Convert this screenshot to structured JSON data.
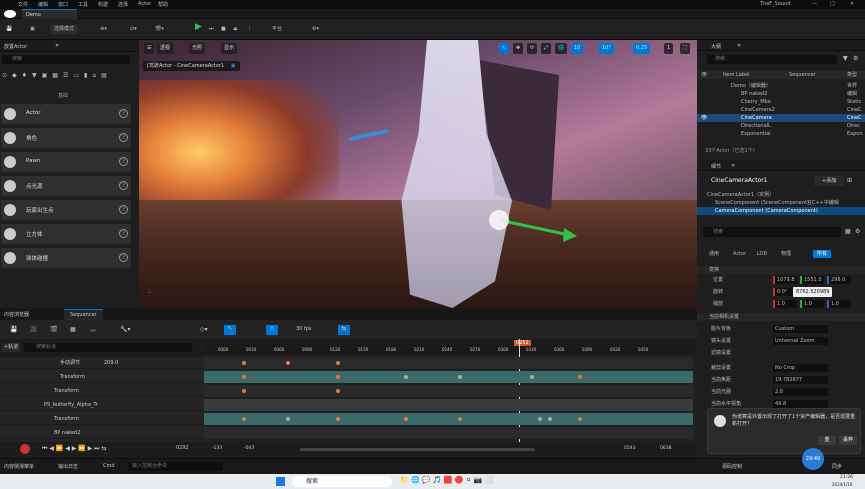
{
  "menubar": {
    "items": [
      "文件",
      "编辑",
      "窗口",
      "工具",
      "构建",
      "选择",
      "Actor",
      "帮助"
    ],
    "project_name": "TheF_Sound"
  },
  "tab": {
    "label": "Demo"
  },
  "toolbar": {
    "mode": "选择模式",
    "platform": "平台"
  },
  "left_panel": {
    "title": "放置Actor",
    "search_placeholder": "搜索",
    "section": "基础",
    "items": [
      "Actor",
      "角色",
      "Pawn",
      "点光源",
      "玩家出生点",
      "立方体",
      "球体碰撞"
    ]
  },
  "viewport": {
    "perspective": "透视",
    "lighting": "光照",
    "show": "显示",
    "pilot_label": "[驾驶Actor - CineCameraActor1",
    "grid_size": "10",
    "rot_snap": "10°",
    "scale_snap": "0.25",
    "cam_speed": "1"
  },
  "outliner": {
    "title": "大纲",
    "search_placeholder": "搜索...",
    "col_label": "Item Label",
    "col_seq": "Sequencer",
    "col_type": "类型",
    "rows": [
      {
        "label": "Demo（编辑器）",
        "type": "世界",
        "selected": false
      },
      {
        "label": "BP naked2",
        "type": "编辑",
        "selected": false
      },
      {
        "label": "Cherry_Mbe",
        "type": "Static",
        "selected": false
      },
      {
        "label": "CineCamera2",
        "type": "CineC",
        "selected": false
      },
      {
        "label": "CineCamera",
        "type": "CineC",
        "selected": true
      },
      {
        "label": "DirectionalL",
        "type": "Direc",
        "selected": false
      },
      {
        "label": "Exponential",
        "type": "Expon",
        "selected": false
      }
    ],
    "footer": "33个Actor（已选1个）"
  },
  "details": {
    "title": "细节",
    "actor_name": "CineCameraActor1",
    "add_button": "+添加",
    "root_component": "CineCameraActor1（实例）",
    "scene_comp": "SceneComponent (SceneComponent)",
    "camera_comp": "CameraComponent (CameraComponent)",
    "edit_in_cpp": "在C++中编辑",
    "search_placeholder": "搜索",
    "filter_tabs": [
      "通用",
      "Actor",
      "LOD",
      "杂项",
      "物理",
      "渲染",
      "流送",
      "所有"
    ],
    "transform_header": "变换",
    "location_label": "位置",
    "rotation_label": "旋转",
    "scale_label": "缩放",
    "loc_x": "1079.8",
    "loc_y": "1551.0",
    "loc_z": "298.0",
    "rot_x": "0.0°",
    "rot_tooltip": "8762.520989",
    "scale_x": "1.0",
    "scale_y": "1.0",
    "scale_z": "1.0",
    "cam_settings_header": "当前相机设置",
    "props": [
      {
        "label": "胶片背板",
        "value": "Custom"
      },
      {
        "label": "镜头设置",
        "value": "Universal Zoom"
      },
      {
        "label": "滤镜设置",
        "value": ""
      },
      {
        "label": "裁剪设置",
        "value": "No Crop"
      },
      {
        "label": "当前焦距",
        "value": "19.782877"
      },
      {
        "label": "当前光圈",
        "value": "2.8"
      },
      {
        "label": "当前水平视角",
        "value": "49.8"
      }
    ]
  },
  "toast": {
    "message": "伪谱算是外置出现了打开了1个资产编辑器，是否需要重新打开？",
    "button": "重",
    "dismiss_button": "丢弃"
  },
  "sequencer": {
    "tabs": [
      "内容浏览器",
      "Sequencer"
    ],
    "fps": "30 fps",
    "add_track": "+轨道",
    "search_placeholder": "搜索轨道",
    "tracks": [
      {
        "label": "手动调节",
        "value": "209.0"
      },
      {
        "label": "Transform",
        "value": ""
      },
      {
        "label": "Transform",
        "value": ""
      },
      {
        "label": "PS_butterfly_Alpha_Tr",
        "value": ""
      },
      {
        "label": "Transform",
        "value": ""
      },
      {
        "label": "BP naked2",
        "value": ""
      }
    ],
    "ruler": [
      "0000",
      "0030",
      "0060",
      "0090",
      "0120",
      "0150",
      "0180",
      "0210",
      "0240",
      "0270",
      "0300",
      "0330",
      "0360",
      "0390",
      "0420",
      "0450"
    ],
    "playhead": "0252",
    "current_frame": "0292",
    "range_start": "-133",
    "range_start2": "-043",
    "range_end": "0543",
    "range_end2": "0638"
  },
  "statusbar": {
    "content_drawer": "内容侧滑菜单",
    "output_log": "输出日志",
    "cmd": "Cmd",
    "cmd_placeholder": "输入控制台命令",
    "source_control": "源码控制",
    "sync": "同步"
  },
  "taskbar": {
    "search_placeholder": "搜索",
    "time": "21:26",
    "date": "2024/1/16"
  }
}
